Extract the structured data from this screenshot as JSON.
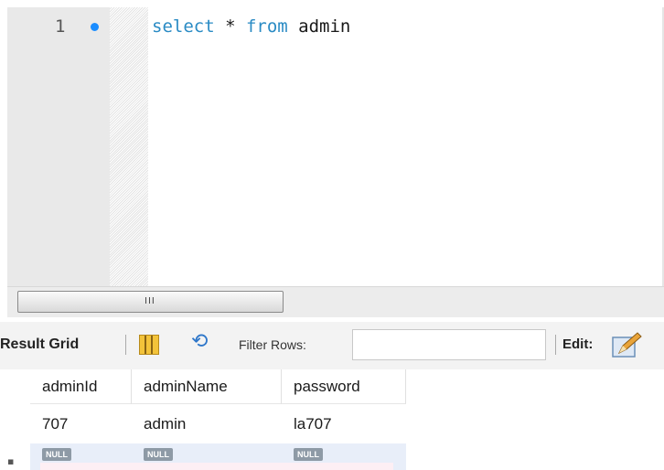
{
  "editor": {
    "line_number": "1",
    "code_tokens": [
      {
        "text": "select",
        "kind": "keyword"
      },
      {
        "text": " * ",
        "kind": "text"
      },
      {
        "text": "from",
        "kind": "keyword"
      },
      {
        "text": " admin",
        "kind": "text"
      }
    ],
    "scroll_grip": "III"
  },
  "toolbar": {
    "result_grid_label": "Result Grid",
    "filter_rows_label": "Filter Rows:",
    "filter_value": "",
    "edit_label": "Edit:"
  },
  "results": {
    "columns": [
      "adminId",
      "adminName",
      "password"
    ],
    "rows": [
      [
        "707",
        "admin",
        "la707"
      ],
      [
        "NULL",
        "NULL",
        "NULL"
      ]
    ]
  },
  "icons": {
    "row_marker": "statement-marker-icon",
    "grid_view": "grid-view-icon",
    "refresh": "refresh-icon",
    "edit": "edit-pencil-icon"
  },
  "colors": {
    "keyword": "#2a8bc4",
    "marker": "#1a8cff",
    "null_badge": "#8e9aa6",
    "selected_row": "#e8eef9"
  }
}
